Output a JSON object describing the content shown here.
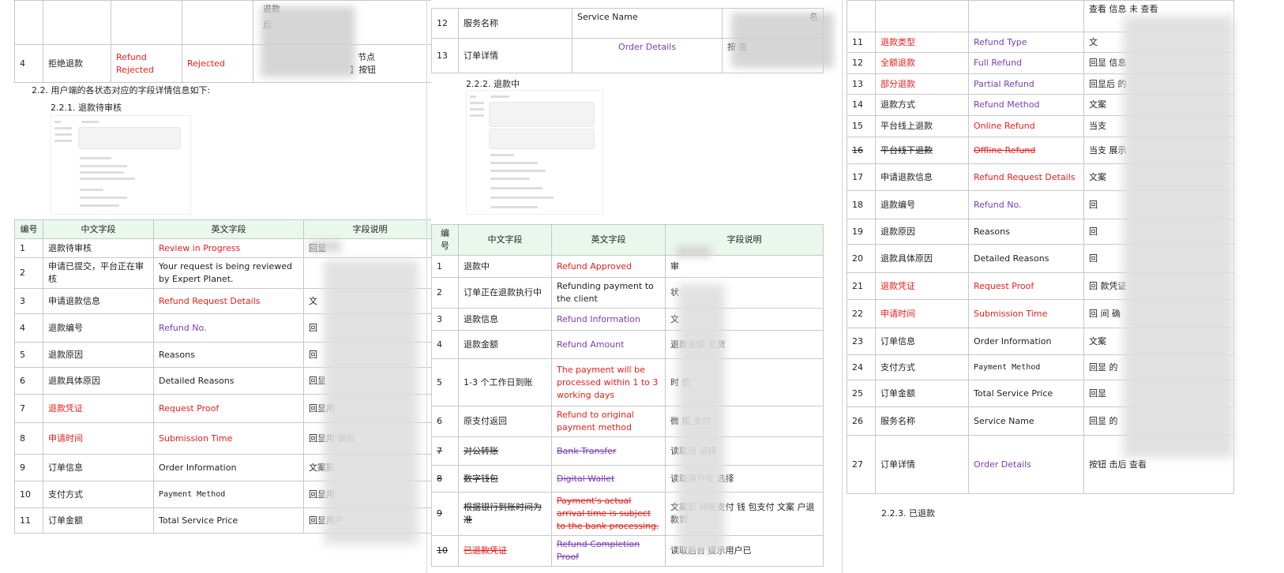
{
  "left": {
    "top_rows": [
      {
        "num": "",
        "zh": "",
        "en": "",
        "en2": "",
        "desc_a": "退款",
        "desc_b": "后"
      },
      {
        "num": "4",
        "zh": "拒绝退款",
        "en": "Refund",
        "en2": "Rejected",
        "en3": "Rejected",
        "desc_a": "节点",
        "desc_b": "】按钮"
      }
    ],
    "heading1": "2.2.  用户端的各状态对应的字段详情信息如下:",
    "heading2": "2.2.1.  退款待审核",
    "headers": [
      "编号",
      "中文字段",
      "英文字段",
      "字段说明"
    ],
    "rows": [
      {
        "num": "1",
        "zh": "退款待审核",
        "en": "Review in Progress",
        "desc": "回显",
        "zh_c": "blk",
        "en_c": "red"
      },
      {
        "num": "2",
        "zh": "申请已提交，平台正在审核",
        "en": "Your request is being reviewed by Expert Planet.",
        "desc": "",
        "zh_c": "blk",
        "en_c": "blk"
      },
      {
        "num": "3",
        "zh": "申请退款信息",
        "en": "Refund Request Details",
        "desc": "文",
        "zh_c": "blk",
        "en_c": "red"
      },
      {
        "num": "4",
        "zh": "退款编号",
        "en": "Refund No.",
        "desc": "回",
        "zh_c": "blk",
        "en_c": "purple"
      },
      {
        "num": "5",
        "zh": "退款原因",
        "en": "Reasons",
        "desc": "回",
        "zh_c": "blk",
        "en_c": "blk"
      },
      {
        "num": "6",
        "zh": "退款具体原因",
        "en": "Detailed Reasons",
        "desc": "回显",
        "zh_c": "blk",
        "en_c": "blk"
      },
      {
        "num": "7",
        "zh": "退款凭证",
        "en": "Request Proof",
        "desc": "回显用",
        "zh_c": "red",
        "en_c": "red"
      },
      {
        "num": "8",
        "zh": "申请时间",
        "en": "Submission Time",
        "desc": "回显用 确到",
        "zh_c": "red",
        "en_c": "red"
      },
      {
        "num": "9",
        "zh": "订单信息",
        "en": "Order Information",
        "desc": "文案影",
        "zh_c": "blk",
        "en_c": "blk"
      },
      {
        "num": "10",
        "zh": "支付方式",
        "en": "Payment Method",
        "desc": "回显用",
        "zh_c": "blk",
        "en_c": "mono"
      },
      {
        "num": "11",
        "zh": "订单金额",
        "en": "Total Service Price",
        "desc": "回显用户",
        "zh_c": "blk",
        "en_c": "blk"
      }
    ]
  },
  "middle": {
    "top_rows": [
      {
        "num": "12",
        "zh": "服务名称",
        "en": "Service Name",
        "desc": "名"
      },
      {
        "num": "13",
        "zh": "订单详情",
        "en": "Order Details",
        "desc": "按 查"
      }
    ],
    "heading": "2.2.2.  退款中",
    "headers": [
      "编号",
      "中文字段",
      "英文字段",
      "字段说明"
    ],
    "rows": [
      {
        "num": "1",
        "zh": "退款中",
        "en": "Refund Approved",
        "desc": "审",
        "en_c": "red",
        "zh_c": "blk",
        "strike": false
      },
      {
        "num": "2",
        "zh": "订单正在退款执行中",
        "en": "Refunding payment to the client",
        "desc": "状",
        "en_c": "blk",
        "zh_c": "blk",
        "strike": false
      },
      {
        "num": "3",
        "zh": "退款信息",
        "en": "Refund Information",
        "desc": "文",
        "en_c": "purple",
        "zh_c": "blk",
        "strike": false
      },
      {
        "num": "4",
        "zh": "退款金额",
        "en": "Refund Amount",
        "desc": "退款金额 显货",
        "en_c": "purple",
        "zh_c": "blk",
        "strike": false
      },
      {
        "num": "5",
        "zh": "1-3 个工作日到账",
        "en": "The payment will be processed within 1 to 3 working days",
        "desc": "时 信",
        "en_c": "red",
        "zh_c": "blk",
        "strike": false
      },
      {
        "num": "6",
        "zh": "原支付返回",
        "en": "Refund to original payment method",
        "desc": "微 提 支付",
        "en_c": "red",
        "zh_c": "blk",
        "strike": false
      },
      {
        "num": "7",
        "zh": "对公转账",
        "en": "Bank Transfer",
        "desc": "读取用 选择",
        "en_c": "purple",
        "zh_c": "blk",
        "strike": true
      },
      {
        "num": "8",
        "zh": "数字钱包",
        "en": "Digital Wallet",
        "desc": "读取用户在 选择",
        "en_c": "purple",
        "zh_c": "blk",
        "strike": true
      },
      {
        "num": "9",
        "zh": "根据银行到账时间为准",
        "en": "Payment's actual arrival time is subject to the bank processing.",
        "desc": "文案影 转账支付 钱 包支付 文案 户退款到",
        "en_c": "red",
        "zh_c": "blk",
        "strike": true
      },
      {
        "num": "10",
        "zh": "已退款凭证",
        "en": "Refund Completion Proof",
        "desc": "读取后台 提示用户已",
        "en_c": "purple",
        "zh_c": "red",
        "strike": true
      }
    ]
  },
  "right": {
    "top_rows": [
      {
        "num": "",
        "zh": "",
        "en": "",
        "desc": "查看 信息 未 查看"
      }
    ],
    "rows": [
      {
        "num": "11",
        "zh": "退款类型",
        "en": "Refund Type",
        "desc": "文",
        "zh_c": "red",
        "en_c": "purple",
        "strike": false
      },
      {
        "num": "12",
        "zh": "全额退款",
        "en": "Full Refund",
        "desc": "回显 信息",
        "zh_c": "red",
        "en_c": "purple",
        "strike": false
      },
      {
        "num": "13",
        "zh": "部分退款",
        "en": "Partial Refund",
        "desc": "回显后 的",
        "zh_c": "red",
        "en_c": "purple",
        "strike": false
      },
      {
        "num": "14",
        "zh": "退款方式",
        "en": "Refund Method",
        "desc": "文案",
        "zh_c": "blk",
        "en_c": "purple",
        "strike": false
      },
      {
        "num": "15",
        "zh": "平台线上退款",
        "en": "Online Refund",
        "desc": "当支",
        "zh_c": "blk",
        "en_c": "red",
        "strike": false
      },
      {
        "num": "16",
        "zh": "平台线下退款",
        "en": "Offline Refund",
        "desc": "当支 展示",
        "zh_c": "blk",
        "en_c": "red",
        "strike": true
      },
      {
        "num": "17",
        "zh": "申请退款信息",
        "en": "Refund Request Details",
        "desc": "文案",
        "zh_c": "blk",
        "en_c": "red",
        "strike": false
      },
      {
        "num": "18",
        "zh": "退款编号",
        "en": "Refund No.",
        "desc": "回",
        "zh_c": "blk",
        "en_c": "purple",
        "strike": false
      },
      {
        "num": "19",
        "zh": "退款原因",
        "en": "Reasons",
        "desc": "回",
        "zh_c": "blk",
        "en_c": "blk",
        "strike": false
      },
      {
        "num": "20",
        "zh": "退款具体原因",
        "en": "Detailed Reasons",
        "desc": "回",
        "zh_c": "blk",
        "en_c": "blk",
        "strike": false
      },
      {
        "num": "21",
        "zh": "退款凭证",
        "en": "Request Proof",
        "desc": "回 款凭证",
        "zh_c": "red",
        "en_c": "red",
        "strike": false
      },
      {
        "num": "22",
        "zh": "申请时间",
        "en": "Submission Time",
        "desc": "回 间 确",
        "zh_c": "red",
        "en_c": "red",
        "strike": false
      },
      {
        "num": "23",
        "zh": "订单信息",
        "en": "Order Information",
        "desc": "文案",
        "zh_c": "blk",
        "en_c": "blk",
        "strike": false
      },
      {
        "num": "24",
        "zh": "支付方式",
        "en": "Payment Method",
        "desc": "回显 的",
        "zh_c": "blk",
        "en_c": "mono",
        "strike": false
      },
      {
        "num": "25",
        "zh": "订单金额",
        "en": "Total Service Price",
        "desc": "回显",
        "zh_c": "blk",
        "en_c": "blk",
        "strike": false
      },
      {
        "num": "26",
        "zh": "服务名称",
        "en": "Service Name",
        "desc": "回显 的",
        "zh_c": "blk",
        "en_c": "blk",
        "strike": false
      },
      {
        "num": "27",
        "zh": "订单详情",
        "en": "Order Details",
        "desc": "按钮 击后 查看",
        "zh_c": "blk",
        "en_c": "purple",
        "strike": false
      }
    ],
    "heading": "2.2.3.  已退款"
  }
}
